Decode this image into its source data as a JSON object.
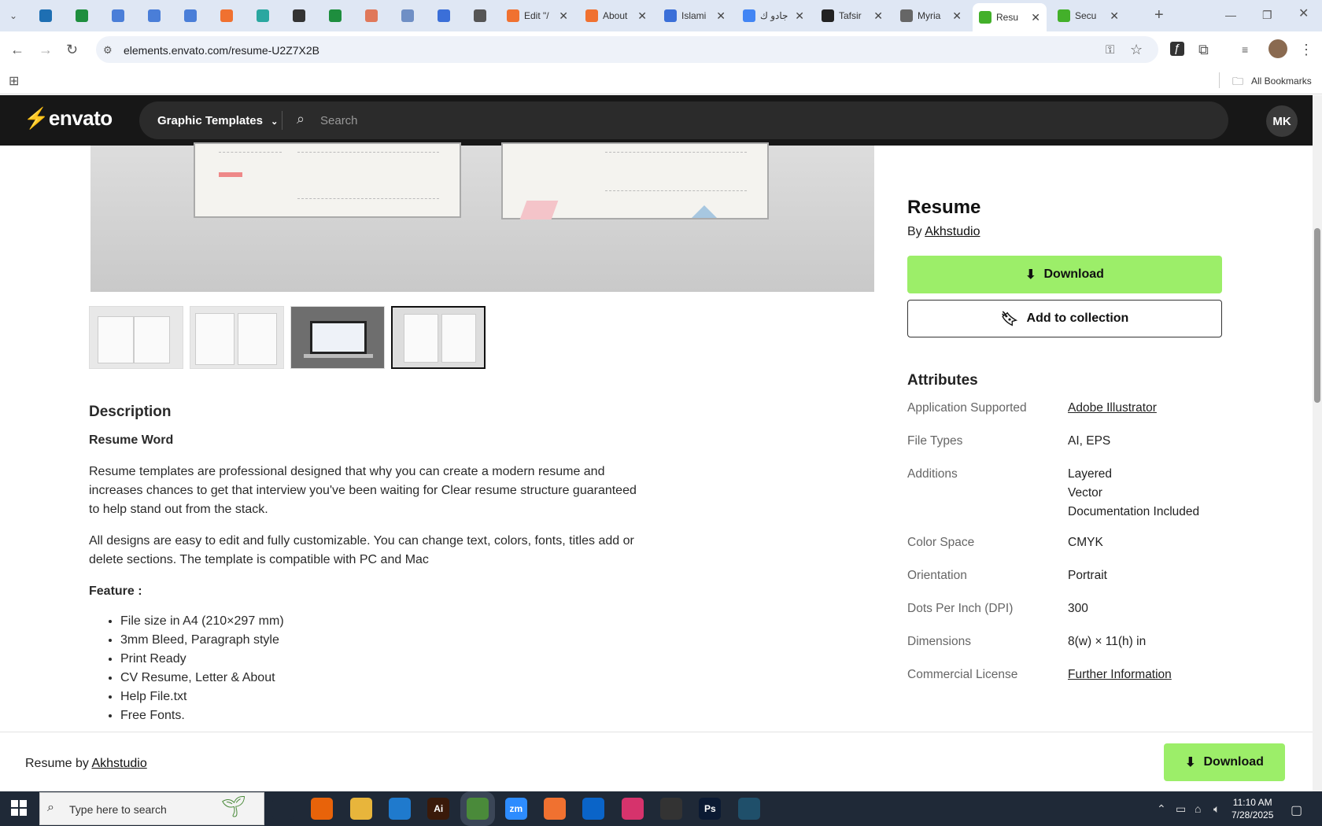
{
  "browser": {
    "tabs": [
      {
        "title": "",
        "icon": "wordpress-icon",
        "color": "#1e6fb3"
      },
      {
        "title": "",
        "icon": "sheets-icon",
        "color": "#1e8e3e"
      },
      {
        "title": "",
        "icon": "docs-icon",
        "color": "#4a7ed8"
      },
      {
        "title": "",
        "icon": "docs-icon",
        "color": "#4a7ed8"
      },
      {
        "title": "",
        "icon": "docs-icon",
        "color": "#4a7ed8"
      },
      {
        "title": "",
        "icon": "xampp-icon",
        "color": "#f07130"
      },
      {
        "title": "",
        "icon": "app-icon",
        "color": "#2aa7a0"
      },
      {
        "title": "",
        "icon": "openai-icon",
        "color": "#333333"
      },
      {
        "title": "",
        "icon": "sheets-icon",
        "color": "#1e8e3e"
      },
      {
        "title": "",
        "icon": "app-icon",
        "color": "#e0785a"
      },
      {
        "title": "",
        "icon": "app-icon",
        "color": "#6f8fc5"
      },
      {
        "title": "",
        "icon": "forms-icon",
        "color": "#3b6fd8"
      },
      {
        "title": "",
        "icon": "audio-icon",
        "color": "#555555"
      },
      {
        "title": "Edit \"/",
        "icon": "xampp-icon",
        "color": "#f07130"
      },
      {
        "title": "About",
        "icon": "xampp-icon",
        "color": "#f07130"
      },
      {
        "title": "Islami",
        "icon": "forms-icon",
        "color": "#3b6fd8"
      },
      {
        "title": "جادو ك",
        "icon": "google-icon",
        "color": "#4285f4"
      },
      {
        "title": "Tafsir",
        "icon": "app-icon",
        "color": "#222222"
      },
      {
        "title": "Myria",
        "icon": "app-icon",
        "color": "#666666"
      },
      {
        "title": "Resu",
        "icon": "envato-icon",
        "color": "#43b02a"
      },
      {
        "title": "Secu",
        "icon": "envato-icon",
        "color": "#43b02a"
      }
    ],
    "new_tab": "+",
    "url": "elements.envato.com/resume-U2Z7X2B",
    "all_bookmarks": "All Bookmarks"
  },
  "site": {
    "logo": "envato",
    "category": "Graphic Templates",
    "search_placeholder": "Search",
    "avatar": "MK"
  },
  "product": {
    "title": "Resume",
    "by": "By",
    "author": "Akhstudio",
    "download": "Download",
    "add_to_collection": "Add to collection"
  },
  "description": {
    "heading": "Description",
    "subheading": "Resume Word",
    "para1": "Resume templates are professional designed that why you can create a modern resume and increases chances to get that interview you've been waiting for Clear resume structure guaranteed to help stand out from the stack.",
    "para2": "All designs are easy to edit and fully customizable. You can change text, colors, fonts, titles add or delete sections. The template is compatible with PC and Mac",
    "feature_heading": "Feature :",
    "features": [
      "File size in A4 (210×297 mm)",
      "3mm Bleed, Paragraph style",
      "Print Ready",
      "CV Resume, Letter & About",
      "Help File.txt",
      "Free Fonts."
    ]
  },
  "attributes": {
    "heading": "Attributes",
    "rows": [
      {
        "key": "Application Supported",
        "value": "Adobe Illustrator"
      },
      {
        "key": "File Types",
        "value": "AI, EPS"
      },
      {
        "key": "Additions",
        "value": "Layered",
        "value2": "Vector",
        "value3": "Documentation Included"
      },
      {
        "key": "Color Space",
        "value": "CMYK"
      },
      {
        "key": "Orientation",
        "value": "Portrait"
      },
      {
        "key": "Dots Per Inch (DPI)",
        "value": "300"
      },
      {
        "key": "Dimensions",
        "value": "8(w) × 11(h) in"
      },
      {
        "key": "Commercial License",
        "value": "Further Information"
      }
    ]
  },
  "sticky": {
    "prefix": "Resume by",
    "author": "Akhstudio",
    "download": "Download"
  },
  "taskbar": {
    "search_placeholder": "Type here to search",
    "time": "11:10 AM",
    "date": "7/28/2025",
    "apps": [
      {
        "label": "",
        "icon": "task-view-icon",
        "color": "#1f2937"
      },
      {
        "label": "",
        "icon": "firefox-icon",
        "color": "#e8630a"
      },
      {
        "label": "",
        "icon": "folder-icon",
        "color": "#e8b53b"
      },
      {
        "label": "",
        "icon": "vscode-icon",
        "color": "#1f7acd"
      },
      {
        "label": "Ai",
        "icon": "illustrator-icon",
        "color": "#3a1a0a"
      },
      {
        "label": "",
        "icon": "chrome-icon",
        "color": "#4a8a3a"
      },
      {
        "label": "zm",
        "icon": "zoom-icon",
        "color": "#2d8cff"
      },
      {
        "label": "",
        "icon": "xampp-icon",
        "color": "#f07130"
      },
      {
        "label": "",
        "icon": "outlook-icon",
        "color": "#0a64c8"
      },
      {
        "label": "",
        "icon": "creative-cloud-icon",
        "color": "#d6336c"
      },
      {
        "label": "",
        "icon": "pen-icon",
        "color": "#333333"
      },
      {
        "label": "Ps",
        "icon": "photoshop-icon",
        "color": "#0b1a33"
      },
      {
        "label": "",
        "icon": "app-icon",
        "color": "#1f4f6a"
      }
    ]
  },
  "colors": {
    "accent_green": "#9cee69",
    "header_bg": "#171717"
  }
}
